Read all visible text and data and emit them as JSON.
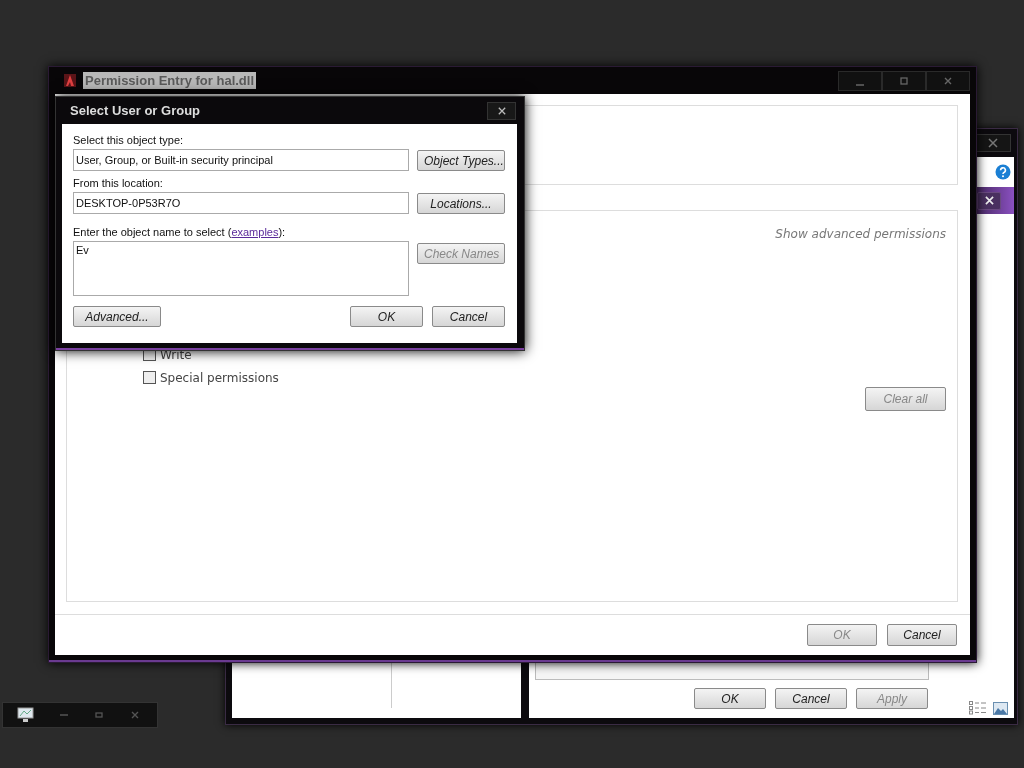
{
  "back_window": {
    "buttons": [
      {
        "label": "OK",
        "disabled": false
      },
      {
        "label": "Cancel",
        "disabled": false
      },
      {
        "label": "Apply",
        "disabled": true
      }
    ]
  },
  "main_window": {
    "title": "Permission Entry for hal.dll",
    "advanced_link": "Show advanced permissions",
    "permissions": [
      {
        "label": "Write",
        "checked": false
      },
      {
        "label": "Special permissions",
        "checked": false
      }
    ],
    "clear_button": {
      "label": "Clear all",
      "disabled": true
    },
    "buttons": [
      {
        "label": "OK",
        "disabled": true
      },
      {
        "label": "Cancel",
        "disabled": false
      }
    ]
  },
  "dialog": {
    "title": "Select User or Group",
    "object_type": {
      "label": "Select this object type:",
      "value": "User, Group, or Built-in security principal",
      "button": {
        "label": "Object Types...",
        "disabled": false
      }
    },
    "location": {
      "label": "From this location:",
      "value": "DESKTOP-0P53R7O",
      "button": {
        "label": "Locations...",
        "disabled": false
      }
    },
    "object_name": {
      "label_before": "Enter the object name to select (",
      "link": "examples",
      "label_after": "):",
      "value": "Ev",
      "button": {
        "label": "Check Names",
        "disabled": true
      }
    },
    "buttons": [
      {
        "label": "Advanced...",
        "disabled": false
      },
      {
        "label": "OK",
        "disabled": false
      },
      {
        "label": "Cancel",
        "disabled": false
      }
    ]
  }
}
